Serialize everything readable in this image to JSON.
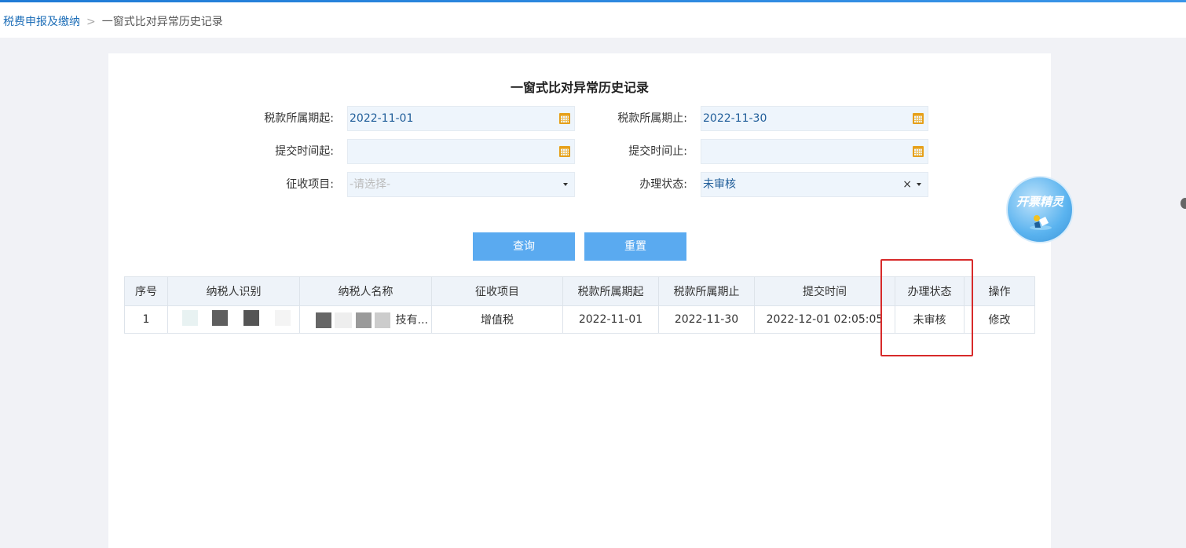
{
  "breadcrumb": {
    "parent": "税费申报及缴纳",
    "separator": ">",
    "current": "一窗式比对异常历史记录"
  },
  "page": {
    "title": "一窗式比对异常历史记录"
  },
  "filters": {
    "period_start_label": "税款所属期起:",
    "period_start_value": "2022-11-01",
    "period_end_label": "税款所属期止:",
    "period_end_value": "2022-11-30",
    "submit_start_label": "提交时间起:",
    "submit_start_value": "",
    "submit_end_label": "提交时间止:",
    "submit_end_value": "",
    "item_label": "征收项目:",
    "item_placeholder": "-请选择-",
    "status_label": "办理状态:",
    "status_value": "未审核",
    "clear_glyph": "×"
  },
  "buttons": {
    "query": "查询",
    "reset": "重置"
  },
  "table": {
    "headers": [
      "序号",
      "纳税人识别",
      "纳税人名称",
      "征收项目",
      "税款所属期起",
      "税款所属期止",
      "提交时间",
      "办理状态",
      "操作"
    ],
    "rows": [
      {
        "index": "1",
        "taxpayer_id": "",
        "taxpayer_name_suffix": "技有...",
        "item": "增值税",
        "period_start": "2022-11-01",
        "period_end": "2022-11-30",
        "submit_time": "2022-12-01 02:05:05",
        "status": "未审核",
        "action": "修改"
      }
    ]
  },
  "widget": {
    "label": "开票精灵",
    "icon": "invoice-sprite-icon"
  },
  "colors": {
    "accent": "#5aaaf0",
    "status_red": "#c92020",
    "link": "#2c7bd1",
    "highlight_box": "#d72a2a"
  }
}
